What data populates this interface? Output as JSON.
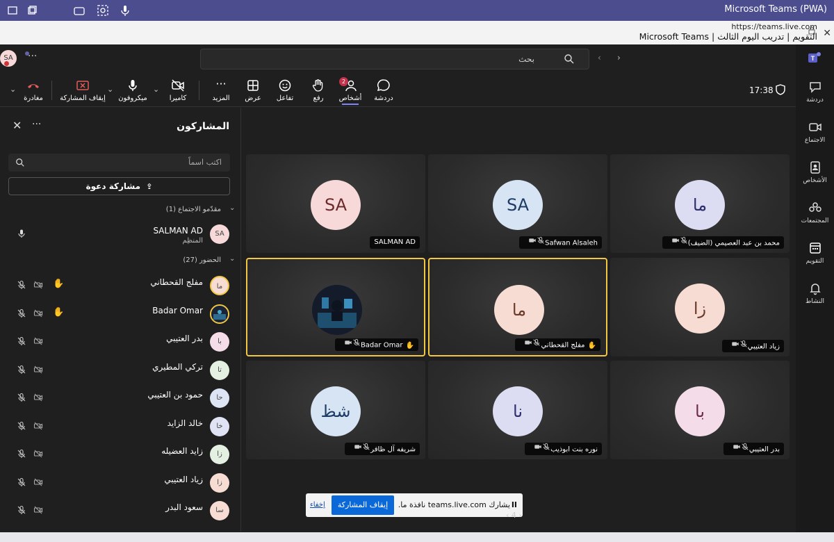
{
  "window": {
    "title": "Microsoft Teams (PWA)",
    "url": "https://teams.live.com",
    "page_title": "التقويم | تدريب اليوم الثالث | Microsoft Teams"
  },
  "header": {
    "search_placeholder": "بحث",
    "user_initials": "SA"
  },
  "rail": [
    {
      "label": "دردشة",
      "icon": "chat-icon"
    },
    {
      "label": "الاجتماع",
      "icon": "meeting-icon"
    },
    {
      "label": "الأشخاص",
      "icon": "people-icon"
    },
    {
      "label": "المجتمعات",
      "icon": "communities-icon"
    },
    {
      "label": "التقويم",
      "icon": "calendar-icon"
    },
    {
      "label": "النشاط",
      "icon": "bell-icon"
    }
  ],
  "toolbar": {
    "time": "17:38",
    "chat": "دردشة",
    "people": "أشخاص",
    "people_badge": "2",
    "raise": "رفع",
    "react": "تفاعل",
    "view": "عرض",
    "more": "المزيد",
    "camera": "كاميرا",
    "mic": "ميكروفون",
    "stop_share": "إيقاف المشاركة",
    "leave": "مغادرة"
  },
  "panel": {
    "title": "المشاركون",
    "search_placeholder": "اكتب اسماً",
    "share_invite": "مشاركة دعوة",
    "presenters_header": "مقدّمو الاجتماع (1)",
    "attendees_header": "الحضور (27)",
    "presenters": [
      {
        "name": "SALMAN AD",
        "role": "المنظِم",
        "initials": "SA",
        "color": "#f6d9d8"
      }
    ],
    "attendees": [
      {
        "name": "مفلج القحطاني",
        "initials": "ما",
        "color": "#f7dcd3",
        "hand": true
      },
      {
        "name": "Badar Omar",
        "initials": "",
        "color": "#223",
        "hand": true
      },
      {
        "name": "بدر العتيبي",
        "initials": "با",
        "color": "#f4dde8",
        "hand": false
      },
      {
        "name": "تركي المطيري",
        "initials": "تا",
        "color": "#e4f1e2",
        "hand": false
      },
      {
        "name": "حمود بن العتيبي",
        "initials": "حا",
        "color": "#dde5f5",
        "hand": false
      },
      {
        "name": "خالد الزايد",
        "initials": "خا",
        "color": "#dfe3f4",
        "hand": false
      },
      {
        "name": "زايد العضيله",
        "initials": "زا",
        "color": "#e4f1e2",
        "hand": false
      },
      {
        "name": "زياد العتيبي",
        "initials": "زا",
        "color": "#f7dcd3",
        "hand": false
      },
      {
        "name": "سعود البدر",
        "initials": "سا",
        "color": "#f7dcd3",
        "hand": false
      }
    ]
  },
  "grid": [
    {
      "name": "محمد بن عبد العصيمي (الضيف)",
      "initials": "ما",
      "bg": "#dcdcf2",
      "fg": "#2d2e6e",
      "highlight": false,
      "hand": false,
      "photo": false
    },
    {
      "name": "Safwan Alsaleh",
      "initials": "SA",
      "bg": "#d6e4f3",
      "fg": "#1d3b66",
      "highlight": false,
      "hand": false,
      "photo": false
    },
    {
      "name": "SALMAN AD",
      "initials": "SA",
      "bg": "#f6d9d8",
      "fg": "#6b2b2b",
      "highlight": false,
      "hand": false,
      "photo": false,
      "plain": true
    },
    {
      "name": "زياد العتيبي",
      "initials": "زا",
      "bg": "#f7dcd3",
      "fg": "#6b3a2b",
      "highlight": false,
      "hand": false,
      "photo": false
    },
    {
      "name": "مفلج القحطاني",
      "initials": "ما",
      "bg": "#f7dcd3",
      "fg": "#6b3a2b",
      "highlight": true,
      "hand": true,
      "photo": false
    },
    {
      "name": "Badar Omar",
      "initials": "",
      "bg": "#1e2638",
      "fg": "#fff",
      "highlight": true,
      "hand": true,
      "photo": true
    },
    {
      "name": "بدر العتيبي",
      "initials": "با",
      "bg": "#f4dde8",
      "fg": "#6b2b4d",
      "highlight": false,
      "hand": false,
      "photo": false
    },
    {
      "name": "نوره بنت ابوذيب",
      "initials": "نا",
      "bg": "#dcdcf2",
      "fg": "#2d2e6e",
      "highlight": false,
      "hand": false,
      "photo": false
    },
    {
      "name": "شريفه آل ظافر",
      "initials": "شظ",
      "bg": "#d6e4f3",
      "fg": "#1d3b66",
      "highlight": false,
      "hand": false,
      "photo": false
    }
  ],
  "share_bar": {
    "message": "يشارك teams.live.com نافذة ما.",
    "stop": "إيقاف المشاركة",
    "hide": "إخفاء"
  },
  "pager": "4"
}
